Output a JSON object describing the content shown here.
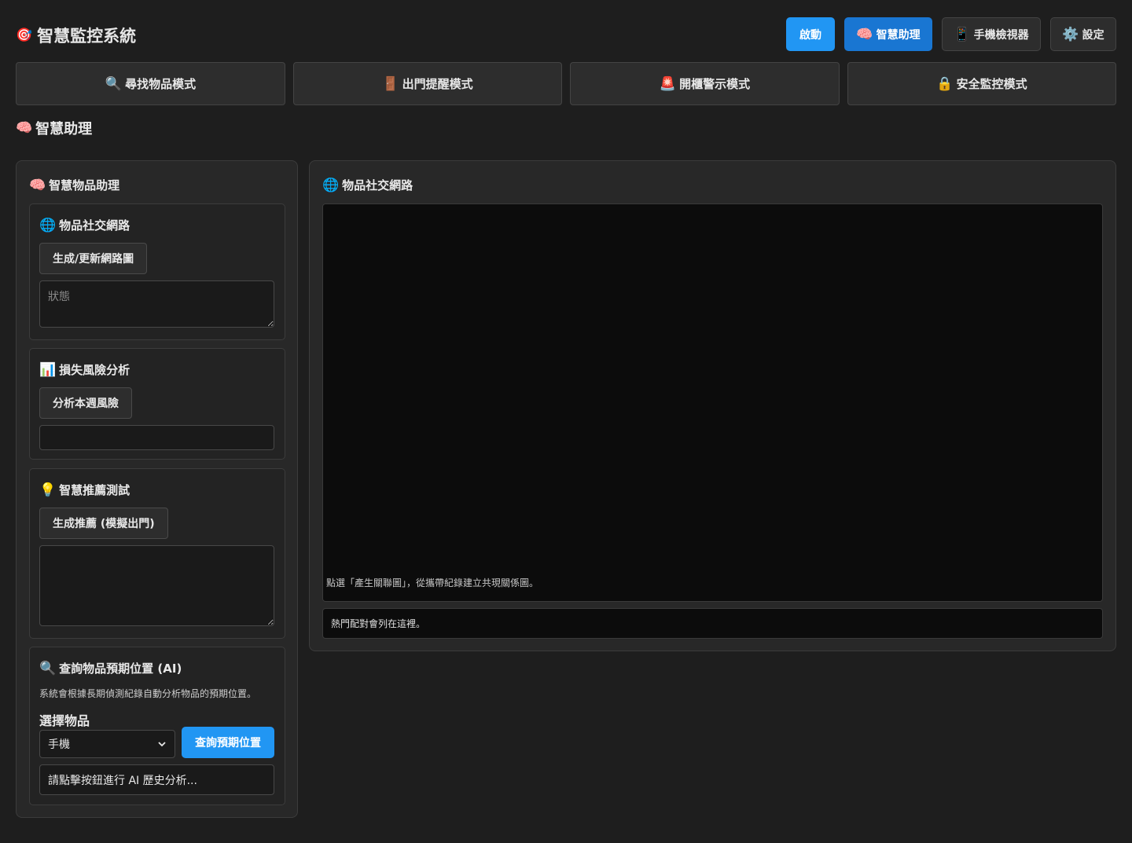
{
  "header": {
    "title": "智慧監控系統",
    "title_icon": "🎯",
    "buttons": {
      "start": "啟動",
      "assistant": "智慧助理",
      "assistant_icon": "🧠",
      "phone_viewer": "手機檢視器",
      "phone_icon": "📱",
      "settings": "設定",
      "settings_icon": "⚙️"
    }
  },
  "modes": [
    {
      "label": "尋找物品模式",
      "icon": "🔍"
    },
    {
      "label": "出門提醒模式",
      "icon": "🚪"
    },
    {
      "label": "開櫃警示模式",
      "icon": "🚨"
    },
    {
      "label": "安全監控模式",
      "icon": "🔒"
    }
  ],
  "section": {
    "title": "智慧助理",
    "icon": "🧠"
  },
  "left_panel": {
    "title": "智慧物品助理",
    "icon": "🧠",
    "network_card": {
      "title": "物品社交網路",
      "icon": "🌐",
      "button": "生成/更新網路圖",
      "status_placeholder": "狀態"
    },
    "risk_card": {
      "title": "損失風險分析",
      "icon": "📊",
      "button": "分析本週風險"
    },
    "recommend_card": {
      "title": "智慧推薦測試",
      "icon": "💡",
      "button": "生成推薦 (模擬出門)"
    },
    "query_card": {
      "title": "查詢物品預期位置 (AI)",
      "icon": "🔍",
      "description": "系統會根據長期偵測紀錄自動分析物品的預期位置。",
      "select_label": "選擇物品",
      "selected_item": "手機",
      "query_button": "查詢預期位置",
      "result": "請點擊按鈕進行 AI 歷史分析..."
    }
  },
  "right_panel": {
    "title": "物品社交網路",
    "icon": "🌐",
    "graph_hint": "點選「產生關聯圖」，從攜帶紀錄建立共現關係圖。",
    "pairs_text": "熱門配對會列在這裡。"
  }
}
